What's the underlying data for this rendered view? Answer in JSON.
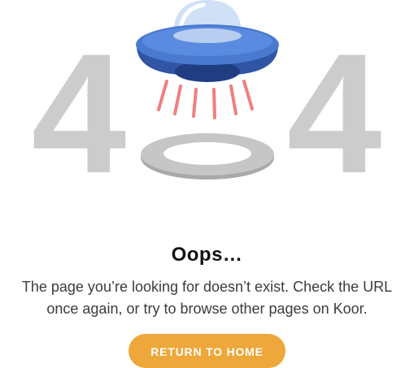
{
  "error_illustration": {
    "left_digit": "4",
    "right_digit": "4",
    "icon": "ufo-icon",
    "colors": {
      "digits": "#cccccc",
      "ufo_body": "#3a64b8",
      "ufo_dome": "#cfe0f7",
      "beam": "#ee8080",
      "ring": "#c6c6c6"
    }
  },
  "heading": "Oops…",
  "message": {
    "line1": "The page you’re looking for doesn’t exist. Check the URL",
    "line2": "once again, or try to browse other pages on Koor."
  },
  "return_button": {
    "label": "RETURN TO HOME",
    "color": "#eea73a"
  }
}
